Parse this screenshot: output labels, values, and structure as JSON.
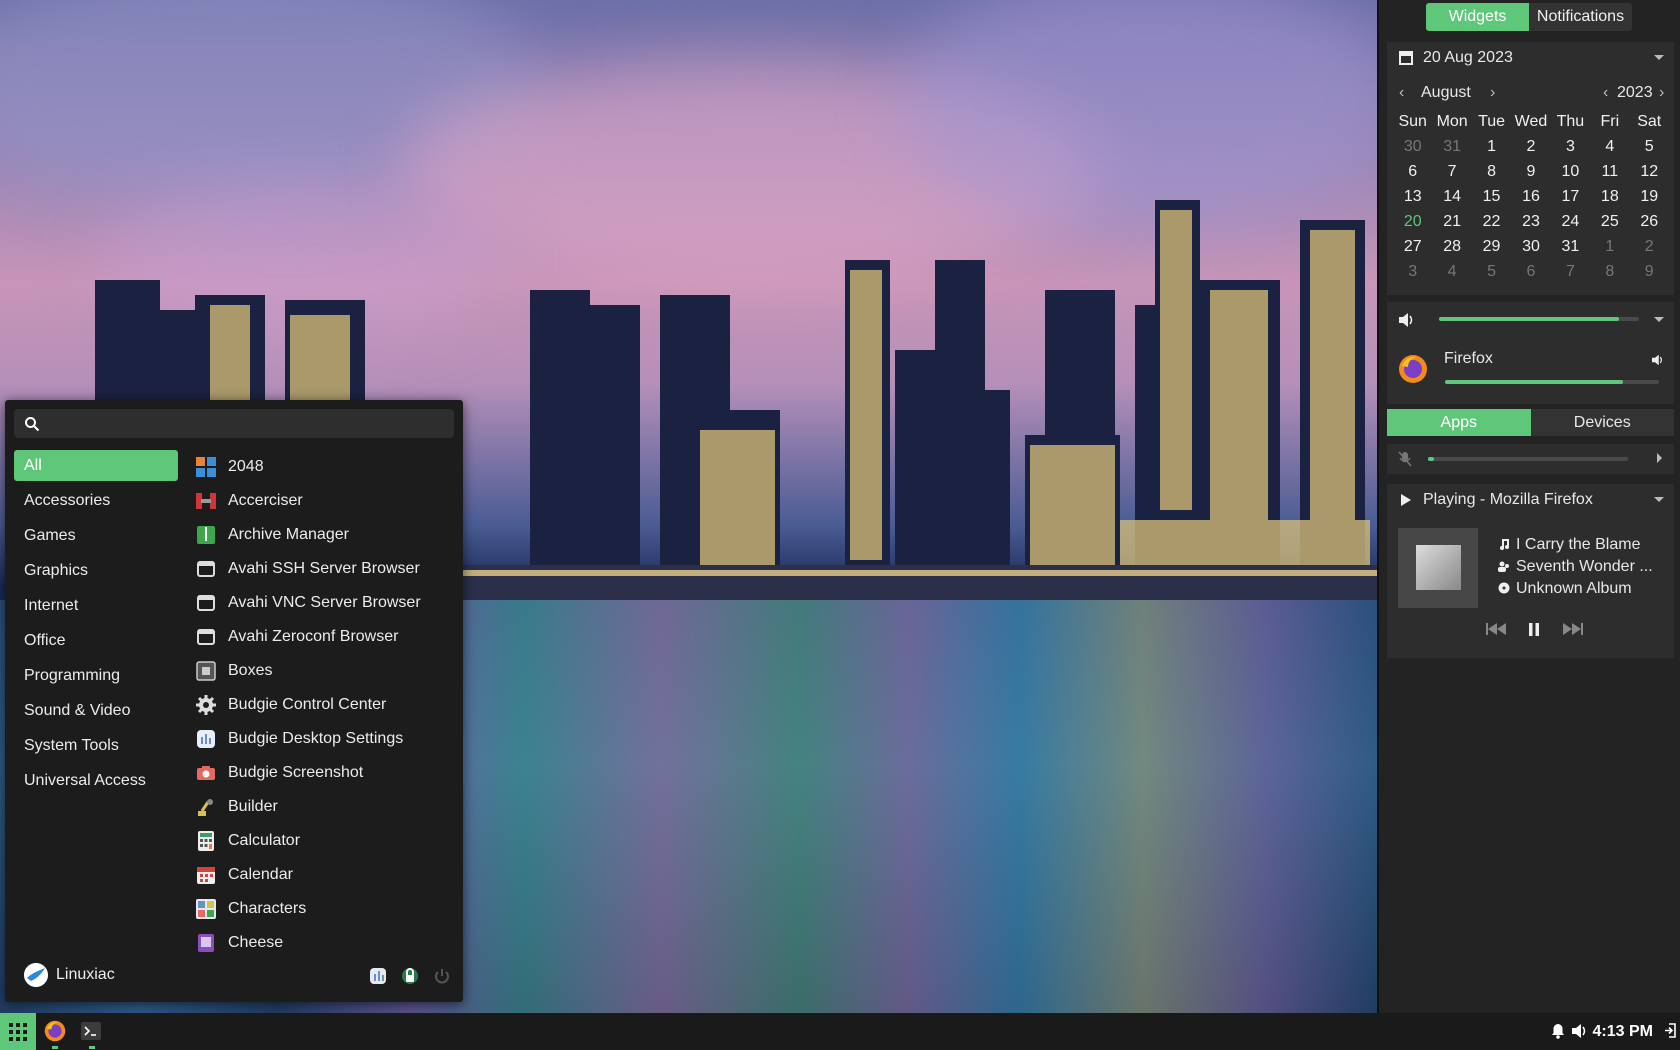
{
  "menu": {
    "search_placeholder": "",
    "categories": [
      "All",
      "Accessories",
      "Games",
      "Graphics",
      "Internet",
      "Office",
      "Programming",
      "Sound & Video",
      "System Tools",
      "Universal Access"
    ],
    "apps": [
      "2048",
      "Accerciser",
      "Archive Manager",
      "Avahi SSH Server Browser",
      "Avahi VNC Server Browser",
      "Avahi Zeroconf Browser",
      "Boxes",
      "Budgie Control Center",
      "Budgie Desktop Settings",
      "Budgie Screenshot",
      "Builder",
      "Calculator",
      "Calendar",
      "Characters",
      "Cheese"
    ],
    "user": "Linuxiac"
  },
  "raven": {
    "tabs": [
      "Widgets",
      "Notifications"
    ],
    "calendar": {
      "date_title": "20 Aug 2023",
      "month": "August",
      "year": "2023",
      "weekdays": [
        "Sun",
        "Mon",
        "Tue",
        "Wed",
        "Thu",
        "Fri",
        "Sat"
      ],
      "weeks": [
        [
          "30",
          "31",
          "1",
          "2",
          "3",
          "4",
          "5"
        ],
        [
          "6",
          "7",
          "8",
          "9",
          "10",
          "11",
          "12"
        ],
        [
          "13",
          "14",
          "15",
          "16",
          "17",
          "18",
          "19"
        ],
        [
          "20",
          "21",
          "22",
          "23",
          "24",
          "25",
          "26"
        ],
        [
          "27",
          "28",
          "29",
          "30",
          "31",
          "1",
          "2"
        ],
        [
          "3",
          "4",
          "5",
          "6",
          "7",
          "8",
          "9"
        ]
      ]
    },
    "sound": {
      "master_volume": 0.9,
      "app_name": "Firefox",
      "app_volume": 0.83,
      "segments": [
        "Apps",
        "Devices"
      ],
      "mic_volume": 0.02
    },
    "media": {
      "title": "Playing - Mozilla Firefox",
      "track": "I Carry the Blame",
      "artist": "Seventh Wonder ...",
      "album": "Unknown Album"
    }
  },
  "taskbar": {
    "clock": "4:13 PM"
  },
  "colors": {
    "accent": "#5fc77a",
    "panel": "#232323",
    "menu_bg": "#1c1c1c"
  }
}
